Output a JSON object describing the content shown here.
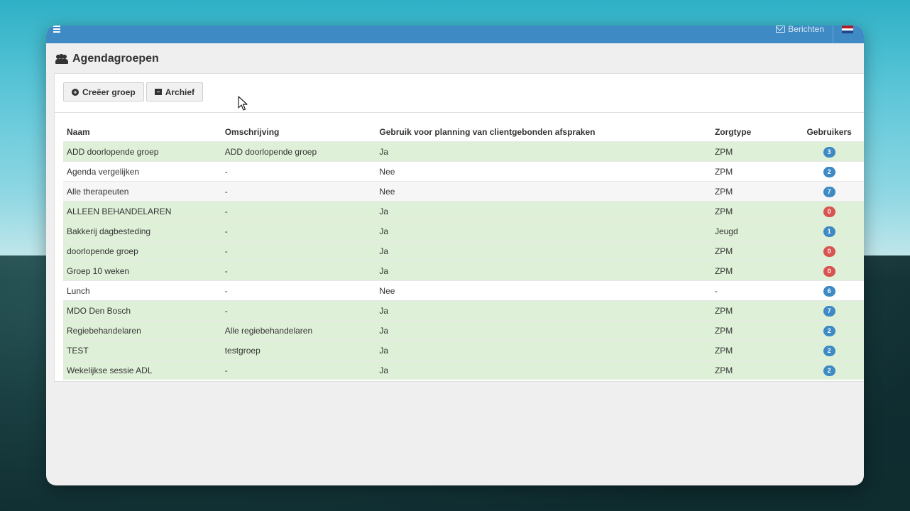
{
  "topbar": {
    "messages_label": "Berichten",
    "flag_colors": [
      "#ae1c28",
      "#ffffff",
      "#21468b"
    ]
  },
  "page": {
    "title": "Agendagroepen",
    "title_icon": "users-icon"
  },
  "toolbar": {
    "create_label": "Creëer groep",
    "create_icon": "plus-circle-icon",
    "archive_label": "Archief",
    "archive_icon": "archive-icon"
  },
  "colors": {
    "topbar": "#3d8ac4",
    "badge_blue": "#3d8ac4",
    "badge_red": "#d9534f",
    "row_green": "#dff0d8"
  },
  "table": {
    "columns": [
      "Naam",
      "Omschrijving",
      "Gebruik voor planning van clientgebonden afspraken",
      "Zorgtype",
      "Gebruikers"
    ],
    "rows": [
      {
        "naam": "ADD doorlopende groep",
        "omschrijving": "ADD doorlopende groep",
        "gebruik": "Ja",
        "zorgtype": "ZPM",
        "gebruikers": "3",
        "badge": "blue",
        "style": "green"
      },
      {
        "naam": "Agenda vergelijken",
        "omschrijving": "-",
        "gebruik": "Nee",
        "zorgtype": "ZPM",
        "gebruikers": "2",
        "badge": "blue",
        "style": "white"
      },
      {
        "naam": "Alle therapeuten",
        "omschrijving": "-",
        "gebruik": "Nee",
        "zorgtype": "ZPM",
        "gebruikers": "7",
        "badge": "blue",
        "style": "grey"
      },
      {
        "naam": "ALLEEN BEHANDELAREN",
        "omschrijving": "-",
        "gebruik": "Ja",
        "zorgtype": "ZPM",
        "gebruikers": "0",
        "badge": "red",
        "style": "green"
      },
      {
        "naam": "Bakkerij dagbesteding",
        "omschrijving": "-",
        "gebruik": "Ja",
        "zorgtype": "Jeugd",
        "gebruikers": "1",
        "badge": "blue",
        "style": "green"
      },
      {
        "naam": "doorlopende groep",
        "omschrijving": "-",
        "gebruik": "Ja",
        "zorgtype": "ZPM",
        "gebruikers": "0",
        "badge": "red",
        "style": "green"
      },
      {
        "naam": "Groep 10 weken",
        "omschrijving": "-",
        "gebruik": "Ja",
        "zorgtype": "ZPM",
        "gebruikers": "0",
        "badge": "red",
        "style": "green"
      },
      {
        "naam": "Lunch",
        "omschrijving": "-",
        "gebruik": "Nee",
        "zorgtype": "-",
        "gebruikers": "6",
        "badge": "blue",
        "style": "white"
      },
      {
        "naam": "MDO Den Bosch",
        "omschrijving": "-",
        "gebruik": "Ja",
        "zorgtype": "ZPM",
        "gebruikers": "7",
        "badge": "blue",
        "style": "green"
      },
      {
        "naam": "Regiebehandelaren",
        "omschrijving": "Alle regiebehandelaren",
        "gebruik": "Ja",
        "zorgtype": "ZPM",
        "gebruikers": "2",
        "badge": "blue",
        "style": "green"
      },
      {
        "naam": "TEST",
        "omschrijving": "testgroep",
        "gebruik": "Ja",
        "zorgtype": "ZPM",
        "gebruikers": "2",
        "badge": "blue",
        "style": "green"
      },
      {
        "naam": "Wekelijkse sessie ADL",
        "omschrijving": "-",
        "gebruik": "Ja",
        "zorgtype": "ZPM",
        "gebruikers": "2",
        "badge": "blue",
        "style": "green"
      }
    ]
  }
}
